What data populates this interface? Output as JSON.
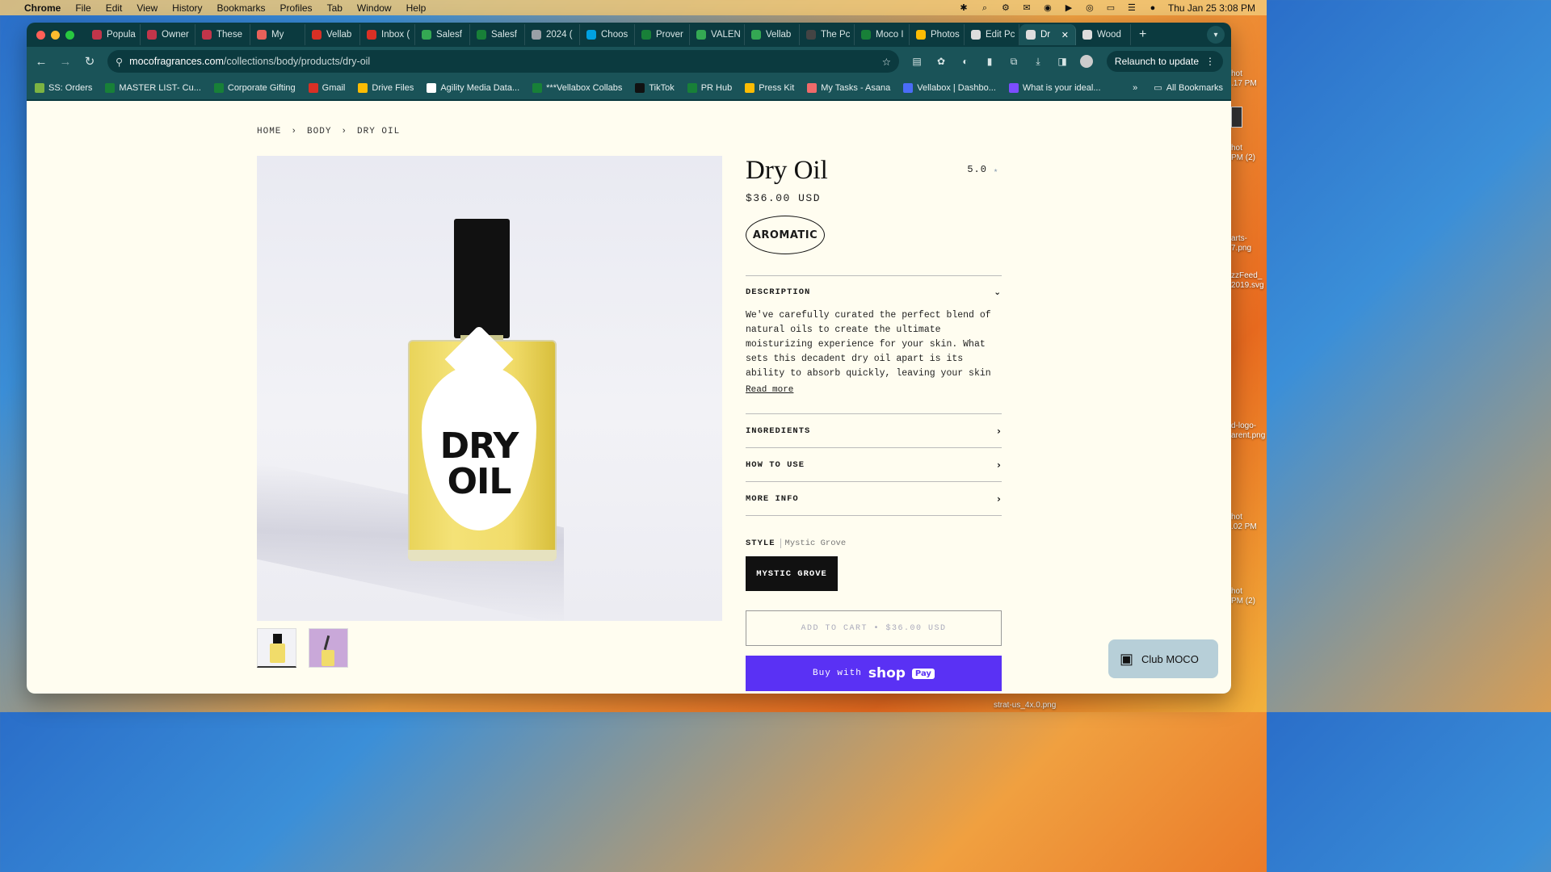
{
  "menubar": {
    "app": "Chrome",
    "items": [
      "File",
      "Edit",
      "View",
      "History",
      "Bookmarks",
      "Profiles",
      "Tab",
      "Window",
      "Help"
    ],
    "clock": "Thu Jan 25  3:08 PM"
  },
  "desktop": {
    "files": [
      {
        "label": "hot\n.17 PM"
      },
      {
        "label": "hot\nPM (2)"
      },
      {
        "label": "arts-\n7.png"
      },
      {
        "label": "zzFeed_\n2019.svg"
      },
      {
        "label": "d-logo-\narent.png"
      },
      {
        "label": "hot\n.02 PM"
      },
      {
        "label": "hot\nPM (2)"
      }
    ],
    "bottom_file": "strat-us_4x.0.png"
  },
  "browser": {
    "tabs": [
      {
        "label": "Popula",
        "color": "#c2354a"
      },
      {
        "label": "Owner",
        "color": "#c2354a"
      },
      {
        "label": "These",
        "color": "#c2354a"
      },
      {
        "label": "My",
        "color": "#e8615a"
      },
      {
        "label": "Vellab",
        "color": "#d93025"
      },
      {
        "label": "Inbox (",
        "color": "#d93025"
      },
      {
        "label": "Salesf",
        "color": "#34a853"
      },
      {
        "label": "Salesf",
        "color": "#188038"
      },
      {
        "label": "2024 (",
        "color": "#9aa0a6"
      },
      {
        "label": "Choos",
        "color": "#00a1e0"
      },
      {
        "label": "Prover",
        "color": "#188038"
      },
      {
        "label": "VALEN",
        "color": "#34a853"
      },
      {
        "label": "Vellab",
        "color": "#34a853"
      },
      {
        "label": "The Pc",
        "color": "#444"
      },
      {
        "label": "Moco I",
        "color": "#188038"
      },
      {
        "label": "Photos",
        "color": "#fbbc04"
      },
      {
        "label": "Edit Pc",
        "color": "#ddd"
      },
      {
        "label": "Dr",
        "color": "#ddd",
        "active": true
      },
      {
        "label": "Wood",
        "color": "#ddd"
      }
    ],
    "url_host": "mocofragrances.com",
    "url_path": "/collections/body/products/dry-oil",
    "relaunch": "Relaunch to update",
    "bookmarks": [
      {
        "label": "SS: Orders",
        "color": "#7cb342"
      },
      {
        "label": "MASTER LIST- Cu...",
        "color": "#188038"
      },
      {
        "label": "Corporate Gifting",
        "color": "#188038"
      },
      {
        "label": "Gmail",
        "color": "#d93025"
      },
      {
        "label": "Drive Files",
        "color": "#fbbc04"
      },
      {
        "label": "Agility Media Data...",
        "color": "#ffffff"
      },
      {
        "label": "***Vellabox Collabs",
        "color": "#188038"
      },
      {
        "label": "TikTok",
        "color": "#111111"
      },
      {
        "label": "PR Hub",
        "color": "#188038"
      },
      {
        "label": "Press Kit",
        "color": "#fbbc04"
      },
      {
        "label": "My Tasks - Asana",
        "color": "#f06a6a"
      },
      {
        "label": "Vellabox | Dashbo...",
        "color": "#4a6cf7"
      },
      {
        "label": "What is your ideal...",
        "color": "#7c4dff"
      }
    ],
    "all_bookmarks": "All Bookmarks"
  },
  "page": {
    "breadcrumb": [
      "HOME",
      "BODY",
      "DRY OIL"
    ],
    "product": {
      "title": "Dry Oil",
      "rating": "5.0",
      "price": "$36.00 USD",
      "badge": "AROMATIC",
      "label_line1": "DRY",
      "label_line2": "OIL"
    },
    "accordion": {
      "description_title": "DESCRIPTION",
      "description_text": "We've carefully curated the perfect blend of natural oils to create the ultimate moisturizing experience for your skin. What sets this decadent dry oil apart is its ability to absorb quickly, leaving your skin",
      "read_more": "Read more",
      "ingredients": "INGREDIENTS",
      "how_to_use": "HOW TO USE",
      "more_info": "MORE INFO"
    },
    "style": {
      "label": "STYLE",
      "value": "Mystic Grove",
      "option": "MYSTIC GROVE"
    },
    "add_to_cart": "ADD TO CART  •  $36.00 USD",
    "buy_with": "Buy with",
    "shop_brand": "shop",
    "shop_pay": "Pay",
    "club": "Club MOCO"
  }
}
